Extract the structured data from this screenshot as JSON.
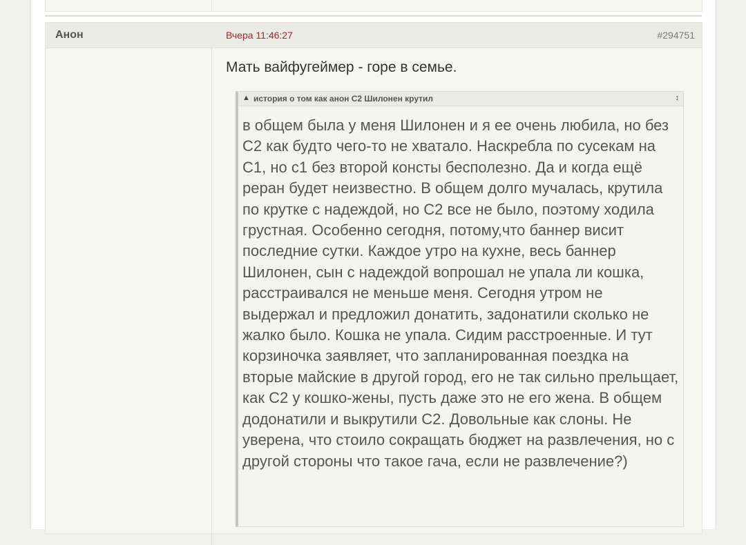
{
  "post": {
    "author": "Анон",
    "date": "Вчера 11:46:27",
    "id": "#294751",
    "title": "Мать вайфугеймер - горе в семье.",
    "spoiler": {
      "arrow": "▲",
      "title": "история о том как анон С2 Шилонен крутил",
      "toggle": "↕",
      "text": "в общем была у меня Шилонен и я ее очень любила, но без С2 как будто чего-то не хватало. Наскребла по сусекам на С1, но с1 без второй консты бесполезно. Да и когда ещё реран будет неизвестно. В общем долго мучалась, крутила по крутке с надеждой, но С2 все не было, поэтому ходила грустная. Особенно сегодня, потому,что баннер висит последние сутки. Каждое утро на кухне, весь баннер Шилонен, сын с надеждой вопрошал не упала ли кошка, расстраивался не меньше меня. Сегодня утром не выдержал и предложил донатить, задонатили сколько не жалко было. Кошка не упала. Сидим расстроенные. И тут корзиночка заявляет, что запланированная поездка на вторые майские в другой город, его не так сильно прельщает, как С2 у кошко-жены, пусть даже это не его жена. В общем додонатили и выкрутили С2. Довольные как слоны. Не уверена, что стоило сокращать бюджет на развлечения, но с другой стороны что такое гача, если не развлечение?)"
    }
  }
}
